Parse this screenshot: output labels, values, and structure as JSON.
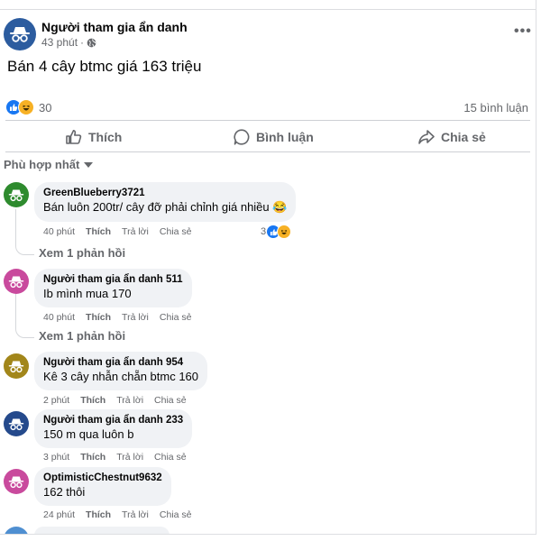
{
  "post": {
    "author": "Người tham gia ẩn danh",
    "time": "43 phút",
    "meta_sep": "·",
    "text": "Bán 4 cây btmc giá 163 triệu",
    "reaction_count": "30",
    "comment_count": "15 bình luận",
    "more_label": "•••"
  },
  "actions": {
    "like": "Thích",
    "comment": "Bình luận",
    "share": "Chia sẻ"
  },
  "sort_label": "Phù hợp nhất",
  "colors": {
    "avatar_anon_1": "#2c5c9f",
    "avatar_green": "#2e8b2e",
    "avatar_pink": "#c94a9d",
    "avatar_olive": "#a2861a",
    "avatar_navy": "#254a8c",
    "avatar_pink2": "#c94a9d",
    "like_blue": "#1877f2",
    "haha_yellow": "#f7b125"
  },
  "comments": [
    {
      "name": "GreenBlueberry3721",
      "text": "Bán luôn 200tr/ cây đỡ phải chỉnh giá nhiều 😂",
      "time": "40 phút",
      "like": "Thích",
      "reply": "Trả lời",
      "share": "Chia sẻ",
      "react_count": "3",
      "replies": "Xem 1 phản hồi"
    },
    {
      "name": "Người tham gia ẩn danh 511",
      "text": "Ib mình mua 170",
      "time": "40 phút",
      "like": "Thích",
      "reply": "Trả lời",
      "share": "Chia sẻ",
      "replies": "Xem 1 phản hồi"
    },
    {
      "name": "Người tham gia ẩn danh 954",
      "text": "Kê 3 cây nhẫn chẵn btmc 160",
      "time": "2 phút",
      "like": "Thích",
      "reply": "Trả lời",
      "share": "Chia sẻ"
    },
    {
      "name": "Người tham gia ẩn danh 233",
      "text": "150 m qua luôn b",
      "time": "3 phút",
      "like": "Thích",
      "reply": "Trả lời",
      "share": "Chia sẻ"
    },
    {
      "name": "OptimisticChestnut9632",
      "text": "162 thôi",
      "time": "24 phút",
      "like": "Thích",
      "reply": "Trả lời",
      "share": "Chia sẻ"
    }
  ]
}
